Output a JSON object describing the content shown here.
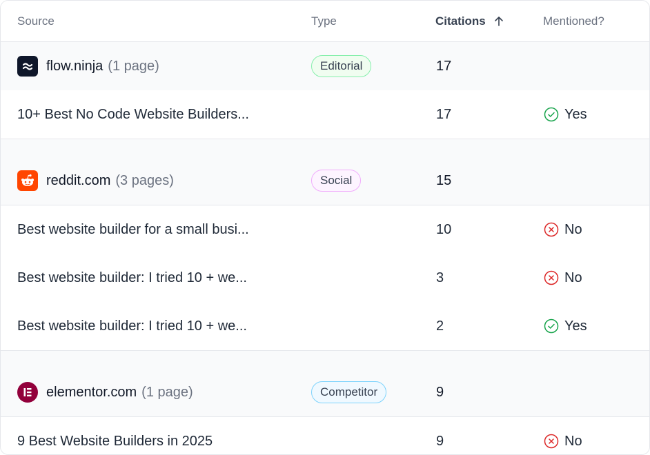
{
  "columns": {
    "source": "Source",
    "type": "Type",
    "citations": "Citations",
    "mentioned": "Mentioned?"
  },
  "colors": {
    "yes": "#16a34a",
    "no": "#dc2626",
    "flow_ninja_logo": "#0f172a",
    "reddit_logo": "#ff4500",
    "elementor_logo": "#92003b"
  },
  "groups": [
    {
      "domain": "flow.ninja",
      "pages": "(1 page)",
      "type": "Editorial",
      "citations": "17",
      "logo_icon": "flow-ninja-logo-icon",
      "rows": [
        {
          "title": "10+ Best No Code Website Builders...",
          "citations": "17",
          "mentioned": "Yes",
          "icon": "check-circle-icon"
        }
      ]
    },
    {
      "domain": "reddit.com",
      "pages": "(3 pages)",
      "type": "Social",
      "citations": "15",
      "logo_icon": "reddit-logo-icon",
      "rows": [
        {
          "title": "Best website builder for a small busi...",
          "citations": "10",
          "mentioned": "No",
          "icon": "x-circle-icon"
        },
        {
          "title": "Best website builder: I tried 10 + we...",
          "citations": "3",
          "mentioned": "No",
          "icon": "x-circle-icon"
        },
        {
          "title": "Best website builder: I tried 10 + we...",
          "citations": "2",
          "mentioned": "Yes",
          "icon": "check-circle-icon"
        }
      ]
    },
    {
      "domain": "elementor.com",
      "pages": "(1 page)",
      "type": "Competitor",
      "citations": "9",
      "logo_icon": "elementor-logo-icon",
      "rows": [
        {
          "title": "9 Best Website Builders in 2025",
          "citations": "9",
          "mentioned": "No",
          "icon": "x-circle-icon"
        }
      ]
    }
  ]
}
